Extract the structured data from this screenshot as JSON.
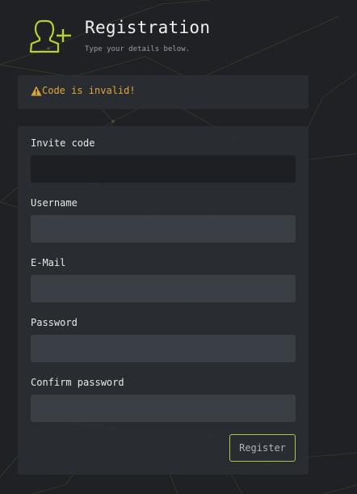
{
  "header": {
    "title": "Registration",
    "subtitle": "Type your details below.",
    "icon": "user-plus-icon",
    "icon_color": "#b5d334"
  },
  "alert": {
    "icon": "warning-icon",
    "text": "Code is invalid!",
    "color": "#e0a43a"
  },
  "form": {
    "fields": [
      {
        "label": "Invite code",
        "value": "",
        "placeholder": ""
      },
      {
        "label": "Username",
        "value": "",
        "placeholder": ""
      },
      {
        "label": "E-Mail",
        "value": "",
        "placeholder": ""
      },
      {
        "label": "Password",
        "value": "",
        "placeholder": ""
      },
      {
        "label": "Confirm password",
        "value": "",
        "placeholder": ""
      }
    ],
    "submit_label": "Register",
    "accent_color": "#a7c64a"
  }
}
